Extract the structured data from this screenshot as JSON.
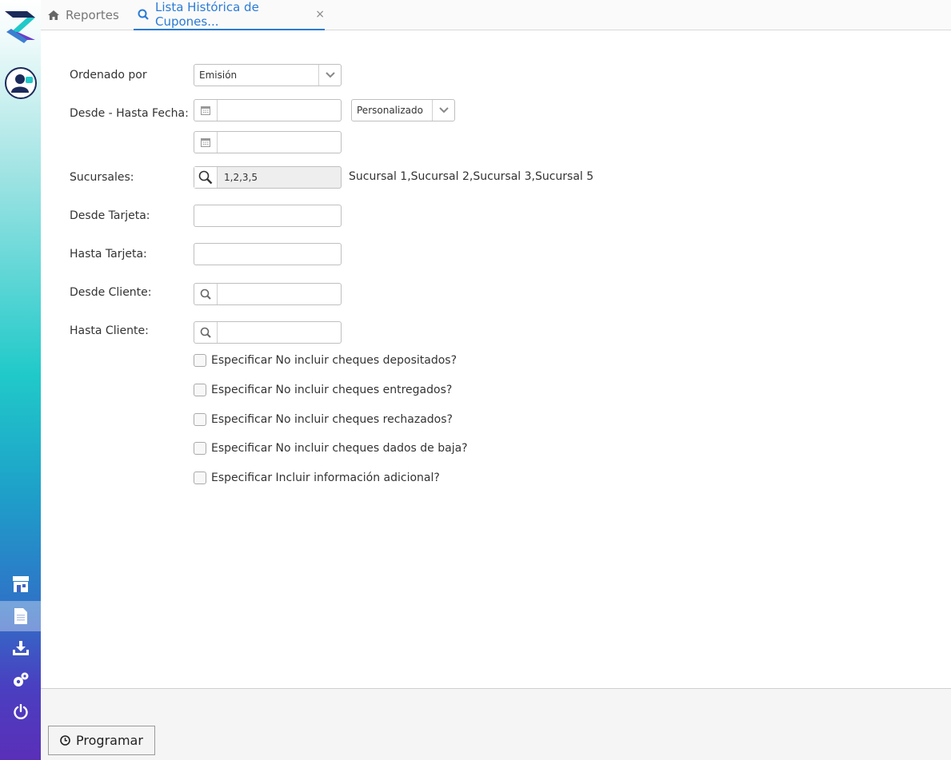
{
  "tabs": {
    "home_label": "Reportes",
    "active_label": "Lista Histórica de Cupones...",
    "close_symbol": "×"
  },
  "form": {
    "ordenado_label": "Ordenado por",
    "ordenado_value": "Emisión",
    "fecha_label": "Desde - Hasta Fecha:",
    "fecha_range_value": "Personalizado",
    "sucursales_label": "Sucursales:",
    "sucursales_value": "1,2,3,5",
    "sucursales_desc": "Sucursal 1,Sucursal 2,Sucursal 3,Sucursal 5",
    "desde_tarjeta_label": "Desde Tarjeta:",
    "hasta_tarjeta_label": "Hasta Tarjeta:",
    "desde_cliente_label": "Desde Cliente:",
    "hasta_cliente_label": "Hasta Cliente:"
  },
  "checkboxes": [
    {
      "label": "Especificar No incluir cheques depositados?",
      "checked": false
    },
    {
      "label": "Especificar No incluir cheques entregados?",
      "checked": false
    },
    {
      "label": "Especificar No incluir cheques rechazados?",
      "checked": false
    },
    {
      "label": "Especificar No incluir cheques dados de baja?",
      "checked": false
    },
    {
      "label": "Especificar Incluir información adicional?",
      "checked": false
    }
  ],
  "footer": {
    "programar_label": "Programar"
  },
  "sidebar": {
    "icons": [
      "store-icon",
      "document-icon",
      "download-icon",
      "settings-icon",
      "power-icon"
    ],
    "active": "document-icon"
  },
  "colors": {
    "accent": "#2b7bd6",
    "sidebar_top": "#20c9c9",
    "sidebar_bottom": "#5a2fb8"
  }
}
